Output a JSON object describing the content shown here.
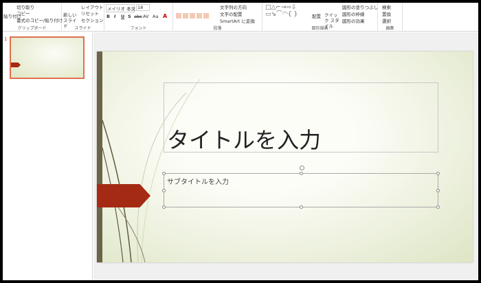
{
  "ribbon": {
    "clipboard": {
      "paste": "貼り付け",
      "cut": "切り取り",
      "copy": "コピー",
      "format_painter": "書式のコピー/貼り付け",
      "label": "クリップボード"
    },
    "slides": {
      "new_slide": "新しい スライド",
      "layout": "レイアウト",
      "reset": "リセット",
      "section": "セクション",
      "label": "スライド"
    },
    "font": {
      "font_name": "メイリオ 本文",
      "font_size": "18",
      "bold": "B",
      "italic": "I",
      "underline": "U",
      "shadow": "S",
      "strike": "abc",
      "spacing": "AV",
      "case": "Aa",
      "label": "フォント"
    },
    "paragraph": {
      "text_direction": "文字列の方向",
      "align_text": "文字の配置",
      "smartart": "SmartArt に変換",
      "label": "段落"
    },
    "drawing": {
      "arrange": "配置",
      "quick_styles": "クイック スタイル",
      "shape_fill": "図形の塗りつぶし",
      "shape_outline": "図形の枠線",
      "shape_effects": "図形の効果",
      "label": "図形描画"
    },
    "editing": {
      "find": "検索",
      "replace": "置換",
      "select": "選択",
      "label": "編集"
    }
  },
  "slide_panel": {
    "slide_number": "1"
  },
  "slide": {
    "title_placeholder": "タイトルを入力",
    "subtitle_placeholder": "サブタイトルを入力"
  },
  "colors": {
    "accent": "#a52a13",
    "bar": "#6b6449",
    "selection": "#e06f4e"
  }
}
